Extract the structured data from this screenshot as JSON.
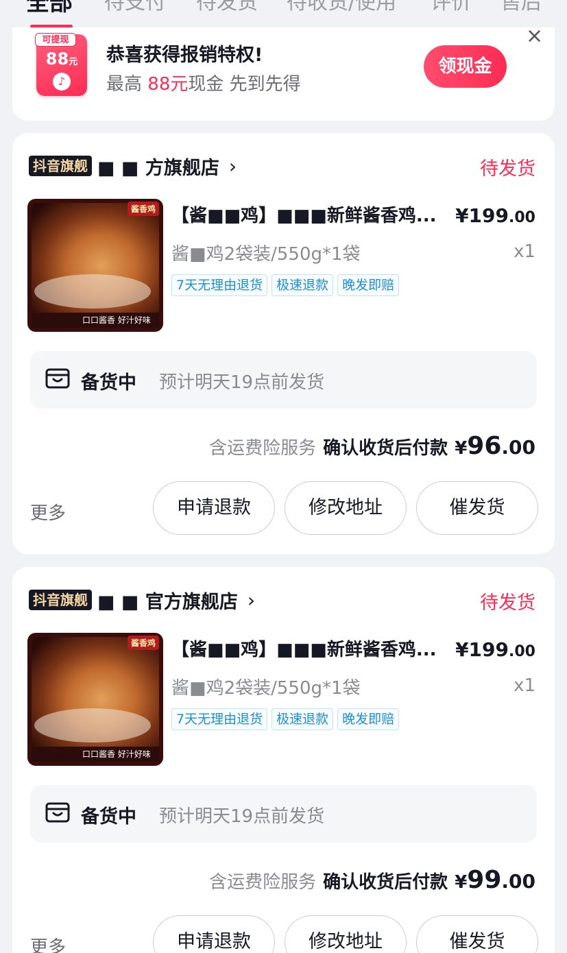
{
  "tabs": [
    "全部",
    "待支付",
    "待发货",
    "待收货/使用",
    "评价",
    "售后"
  ],
  "banner": {
    "coupon_tag": "可提现",
    "coupon_amount": "88",
    "coupon_unit": "元",
    "title": "恭喜获得报销特权!",
    "sub_prefix": "最高",
    "sub_highlight": "88元",
    "sub_suffix": "现金 先到先得",
    "button": "领现金",
    "close": "×"
  },
  "orders": [
    {
      "shop_tag": "抖音旗舰",
      "shop_name": "■ ■ 方旗舰店",
      "status": "待发货",
      "image_badge": "酱香鸡",
      "image_strip": "口口酱香 好汁好味",
      "title": "【酱■■鸡】■■■新鲜酱香鸡...",
      "price_int": "¥199",
      "price_dec": ".00",
      "spec": "酱■鸡2袋装/550g*1袋",
      "qty": "x1",
      "tags": [
        "7天无理由退货",
        "极速退款",
        "晚发即赔"
      ],
      "stock_title": "备货中",
      "stock_desc": "预计明天19点前发货",
      "insurance": "含运费险服务",
      "pay_label": "确认收货后付款",
      "pay_sym": "¥",
      "pay_int": "96",
      "pay_dec": ".00",
      "more": "更多",
      "buttons": [
        "申请退款",
        "修改地址",
        "催发货"
      ]
    },
    {
      "shop_tag": "抖音旗舰",
      "shop_name": "■ ■ 官方旗舰店",
      "status": "待发货",
      "image_badge": "酱香鸡",
      "image_strip": "口口酱香 好汁好味",
      "title": "【酱■■鸡】■■■新鲜酱香鸡...",
      "price_int": "¥199",
      "price_dec": ".00",
      "spec": "酱■鸡2袋装/550g*1袋",
      "qty": "x1",
      "tags": [
        "7天无理由退货",
        "极速退款",
        "晚发即赔"
      ],
      "stock_title": "备货中",
      "stock_desc": "预计明天19点前发货",
      "insurance": "含运费险服务",
      "pay_label": "确认收货后付款",
      "pay_sym": "¥",
      "pay_int": "99",
      "pay_dec": ".00",
      "more": "更多",
      "buttons": [
        "申请退款",
        "修改地址",
        "催发货"
      ]
    }
  ]
}
